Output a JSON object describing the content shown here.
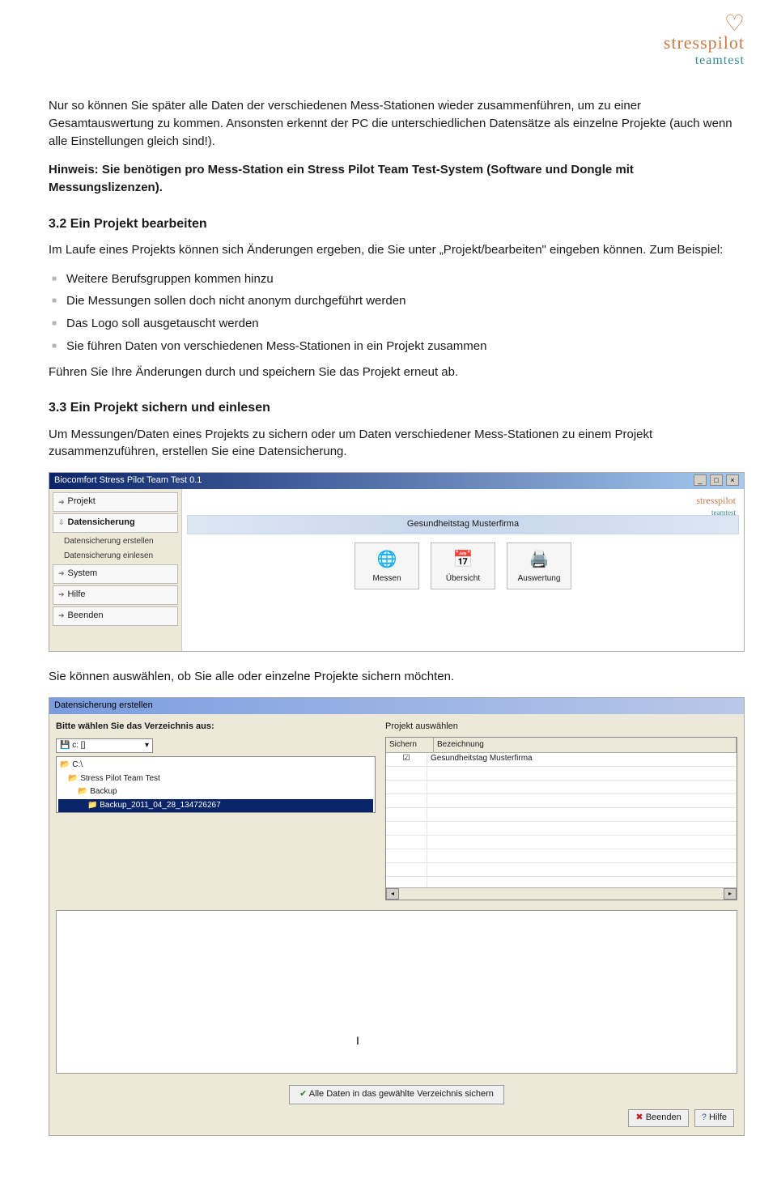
{
  "logo": {
    "brand": "stresspilot",
    "sub": "teamtest"
  },
  "intro1": "Nur so können Sie später alle Daten der verschiedenen Mess-Stationen wieder zusammenführen, um zu einer Gesamtauswertung zu kommen. Ansonsten erkennt der PC die unterschiedlichen Datensätze als einzelne Projekte (auch wenn alle Einstellungen gleich sind!).",
  "intro2": "Hinweis: Sie benötigen pro Mess-Station ein Stress Pilot Team Test-System (Software und Dongle mit Messungslizenzen).",
  "h32": "3.2  Ein Projekt bearbeiten",
  "p32": "Im Laufe eines Projekts können sich Änderungen ergeben, die Sie unter „Projekt/bearbeiten\" eingeben können. Zum Beispiel:",
  "bullets": [
    "Weitere Berufsgruppen kommen hinzu",
    "Die Messungen sollen doch nicht anonym durchgeführt werden",
    "Das Logo soll ausgetauscht werden",
    "Sie führen Daten von verschiedenen Mess-Stationen in ein Projekt zusammen"
  ],
  "p32b": "Führen Sie Ihre Änderungen durch und speichern Sie das Projekt erneut ab.",
  "h33": "3.3  Ein Projekt sichern und einlesen",
  "p33": "Um Messungen/Daten eines Projekts zu sichern oder um Daten verschiedener Mess-Stationen zu einem Projekt zusammenzuführen, erstellen Sie eine Datensicherung.",
  "p_mid": "Sie können auswählen, ob Sie alle oder einzelne Projekte sichern möchten.",
  "app": {
    "title": "Biocomfort Stress Pilot Team Test 0.1",
    "sidebar": {
      "projekt": "Projekt",
      "datensicherung": "Datensicherung",
      "ds_erstellen": "Datensicherung erstellen",
      "ds_einlesen": "Datensicherung einlesen",
      "system": "System",
      "hilfe": "Hilfe",
      "beenden": "Beenden"
    },
    "header_title": "Gesundheitstag Musterfirma",
    "actions": {
      "messen": "Messen",
      "uebersicht": "Übersicht",
      "auswertung": "Auswertung"
    }
  },
  "dialog": {
    "title": "Datensicherung erstellen",
    "choose_dir": "Bitte wählen Sie das Verzeichnis aus:",
    "drive": "c: []",
    "tree": {
      "root": "C:\\",
      "l1": "Stress Pilot Team Test",
      "l2": "Backup",
      "l3": "Backup_2011_04_28_134726267"
    },
    "proj_label": "Projekt auswählen",
    "col_sichern": "Sichern",
    "col_bez": "Bezeichnung",
    "row1": "Gesundheitstag Musterfirma",
    "save_btn": "Alle Daten in das gewählte Verzeichnis sichern",
    "beenden": "Beenden",
    "hilfe": "Hilfe"
  }
}
